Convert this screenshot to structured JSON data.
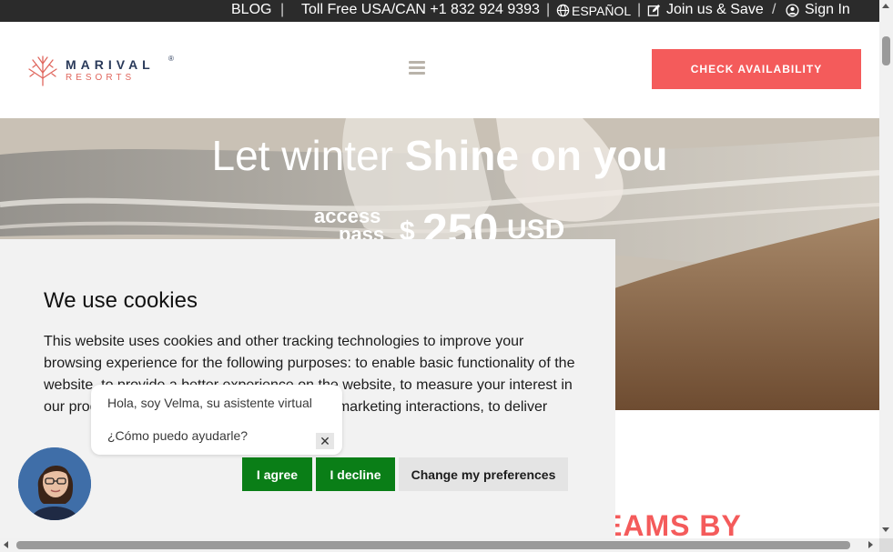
{
  "topbar": {
    "blog": "BLOG",
    "phone": "Toll Free USA/CAN +1 832 924 9393",
    "language": "ESPAÑOL",
    "join": "Join us & Save",
    "signin": "Sign In",
    "separator_bar": "|",
    "separator_slash": "/"
  },
  "header": {
    "logo_name": "MARIVAL",
    "logo_registered": "®",
    "logo_sub": "RESORTS",
    "cta_label": "CHECK AVAILABILITY"
  },
  "hero": {
    "headline_light": "Let winter ",
    "headline_bold": "Shine on you",
    "offer_access": "access",
    "offer_pass": "pass",
    "offer_currency": "$",
    "offer_amount": "250",
    "offer_unit": "USD"
  },
  "section": {
    "partial_heading": "EAMS BY"
  },
  "cookie": {
    "title": "We use cookies",
    "body": "This website uses cookies and other tracking technologies to improve your browsing experience for the following purposes: to enable basic functionality of the website, to provide a better experience on the website, to measure your interest in our products and services and to personalize marketing interactions, to deliver",
    "agree": "I agree",
    "decline": "I decline",
    "preferences": "Change my preferences"
  },
  "chat": {
    "greeting": "Hola, soy Velma, su asistente virtual",
    "question": "¿Cómo puedo ayudarle?",
    "close": "✕"
  },
  "icons": {
    "globe": "globe-icon",
    "edit": "edit-icon",
    "user": "user-circle-icon",
    "menu": "hamburger-menu-icon",
    "close": "close-icon"
  },
  "colors": {
    "topbar_bg": "#2b2b2b",
    "cta_bg": "#f45b5b",
    "accept_green": "#0a7e17",
    "accent_red": "#f45b5b",
    "logo_navy": "#2a3a5a",
    "logo_coral": "#e0675e"
  }
}
